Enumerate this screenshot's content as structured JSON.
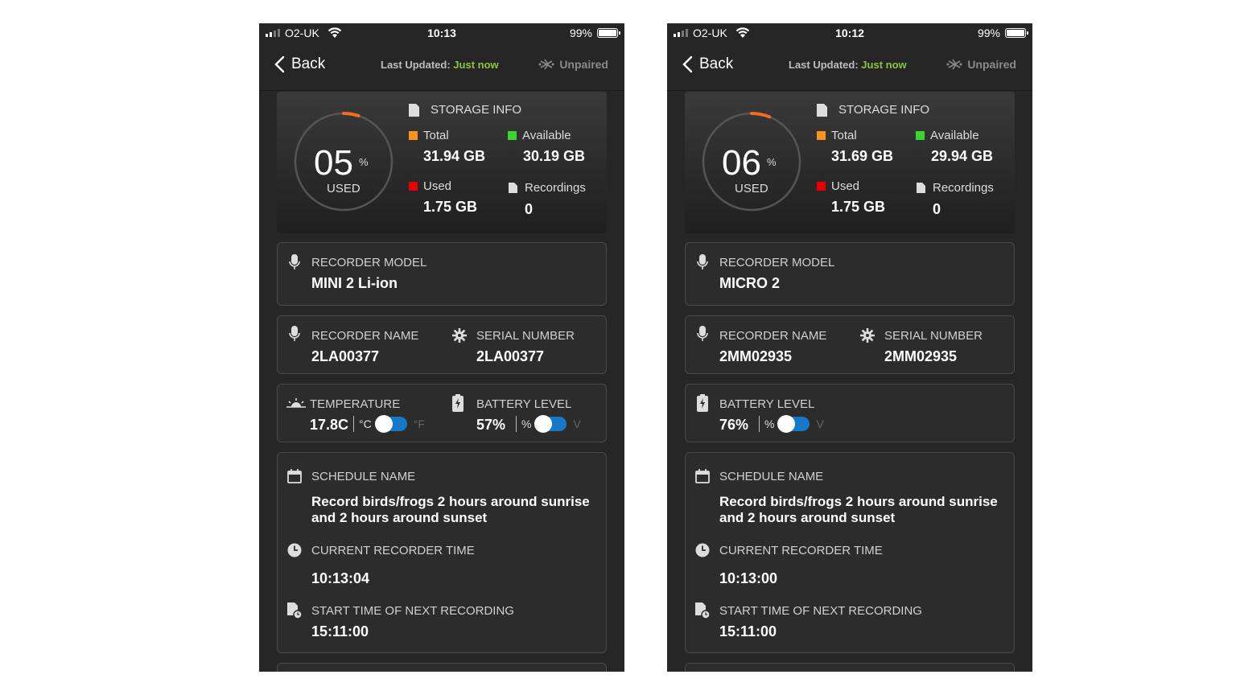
{
  "phones": [
    {
      "status": {
        "carrier": "O2-UK",
        "time": "10:13",
        "battery": "99%"
      },
      "nav": {
        "back": "Back",
        "updated_label": "Last Updated:",
        "updated_value": "Just now",
        "pair_status": "Unpaired"
      },
      "storage": {
        "title": "STORAGE INFO",
        "used_pct": "05",
        "pct_unit": "%",
        "used_label": "USED",
        "used_fraction": 0.05,
        "total_label": "Total",
        "total_value": "31.94 GB",
        "available_label": "Available",
        "available_value": "30.19 GB",
        "used_label2": "Used",
        "used_value": "1.75 GB",
        "recordings_label": "Recordings",
        "recordings_value": "0"
      },
      "model": {
        "label": "RECORDER MODEL",
        "value": "MINI 2 Li-ion"
      },
      "name": {
        "label": "RECORDER NAME",
        "value": "2LA00377"
      },
      "serial": {
        "label": "SERIAL NUMBER",
        "value": "2LA00377"
      },
      "temperature": {
        "label": "TEMPERATURE",
        "value": "17.8C",
        "unit_on": "°C",
        "unit_off": "°F"
      },
      "battery": {
        "label": "BATTERY LEVEL",
        "value": "57%",
        "unit_on": "%",
        "unit_off": "V"
      },
      "schedule": {
        "label": "SCHEDULE NAME",
        "line1": "Record birds/frogs 2 hours around sunrise",
        "line2": "and 2 hours around sunset",
        "time_label": "CURRENT RECORDER TIME",
        "time_value": "10:13:04",
        "next_label": "START TIME OF NEXT RECORDING",
        "next_value": "15:11:00"
      }
    },
    {
      "status": {
        "carrier": "O2-UK",
        "time": "10:12",
        "battery": "99%"
      },
      "nav": {
        "back": "Back",
        "updated_label": "Last Updated:",
        "updated_value": "Just now",
        "pair_status": "Unpaired"
      },
      "storage": {
        "title": "STORAGE INFO",
        "used_pct": "06",
        "pct_unit": "%",
        "used_label": "USED",
        "used_fraction": 0.06,
        "total_label": "Total",
        "total_value": "31.69 GB",
        "available_label": "Available",
        "available_value": "29.94 GB",
        "used_label2": "Used",
        "used_value": "1.75 GB",
        "recordings_label": "Recordings",
        "recordings_value": "0"
      },
      "model": {
        "label": "RECORDER MODEL",
        "value": "MICRO 2"
      },
      "name": {
        "label": "RECORDER NAME",
        "value": "2MM02935"
      },
      "serial": {
        "label": "SERIAL NUMBER",
        "value": "2MM02935"
      },
      "battery": {
        "label": "BATTERY LEVEL",
        "value": "76%",
        "unit_on": "%",
        "unit_off": "V"
      },
      "schedule": {
        "label": "SCHEDULE NAME",
        "line1": "Record birds/frogs 2 hours around sunrise",
        "line2": "and 2 hours around sunset",
        "time_label": "CURRENT RECORDER TIME",
        "time_value": "10:13:00",
        "next_label": "START TIME OF NEXT RECORDING",
        "next_value": "15:11:00"
      }
    }
  ],
  "colors": {
    "total": "#f7931e",
    "available": "#39d62e",
    "used": "#e60000",
    "ring_track": "#555555",
    "ring_arc": "#f26d21",
    "updated_value": "#8bc53f",
    "toggle": "#1778c9"
  }
}
